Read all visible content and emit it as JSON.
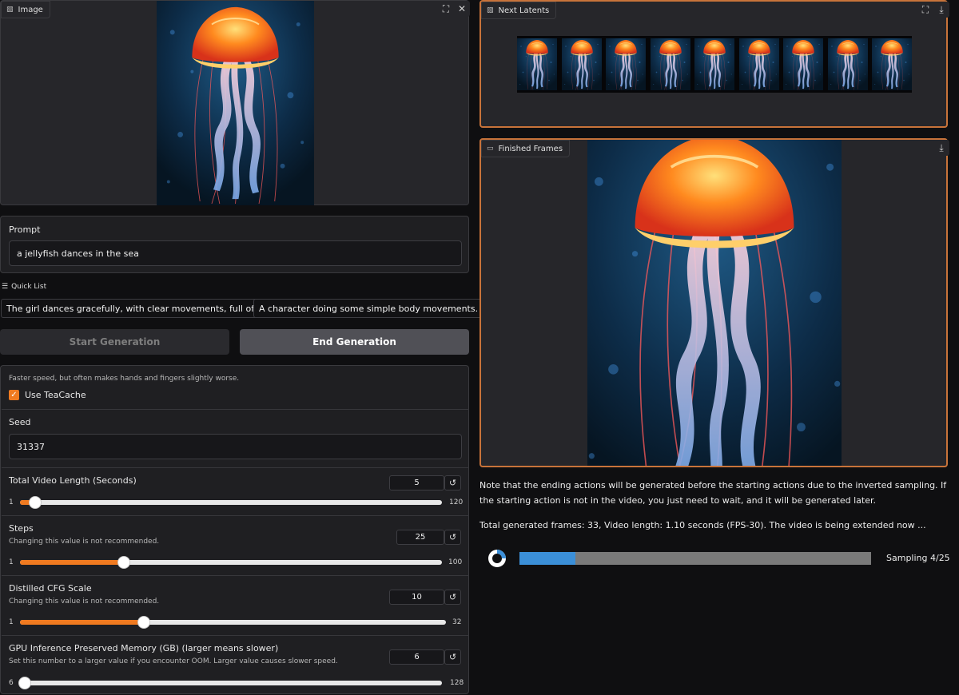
{
  "image_panel": {
    "label": "Image"
  },
  "prompt": {
    "label": "Prompt",
    "value": "a jellyfish dances in the sea"
  },
  "quick_list": {
    "label": "Quick List",
    "items": [
      "The girl dances gracefully, with clear movements, full of charm.",
      "A character doing some simple body movements."
    ]
  },
  "buttons": {
    "start": "Start Generation",
    "end": "End Generation"
  },
  "teacache": {
    "info": "Faster speed, but often makes hands and fingers slightly worse.",
    "label": "Use TeaCache",
    "checked": true
  },
  "seed": {
    "label": "Seed",
    "value": "31337"
  },
  "sliders": [
    {
      "label": "Total Video Length (Seconds)",
      "info": "",
      "value": "5",
      "min": "1",
      "max": "120",
      "fraction": 0.036
    },
    {
      "label": "Steps",
      "info": "Changing this value is not recommended.",
      "value": "25",
      "min": "1",
      "max": "100",
      "fraction": 0.246
    },
    {
      "label": "Distilled CFG Scale",
      "info": "Changing this value is not recommended.",
      "value": "10",
      "min": "1",
      "max": "32",
      "fraction": 0.29
    },
    {
      "label": "GPU Inference Preserved Memory (GB) (larger means slower)",
      "info": "Set this number to a larger value if you encounter OOM. Larger value causes slower speed.",
      "value": "6",
      "min": "6",
      "max": "128",
      "fraction": 0.0
    }
  ],
  "next_latents": {
    "label": "Next Latents",
    "frame_count": 9
  },
  "finished_frames": {
    "label": "Finished Frames"
  },
  "notes": {
    "ordering": "Note that the ending actions will be generated before the starting actions due to the inverted sampling. If the starting action is not in the video, you just need to wait, and it will be generated later.",
    "status": "Total generated frames: 33, Video length: 1.10 seconds (FPS-30). The video is being extended now ..."
  },
  "progress": {
    "label": "Sampling 4/25",
    "fraction": 0.16
  },
  "colors": {
    "accent": "#f07a20",
    "progress": "#3b8fd8",
    "panel": "#1f1f22"
  },
  "icons": {
    "image": "image-icon",
    "fullscreen": "fullscreen-icon",
    "close": "close-icon",
    "download": "download-icon",
    "video": "video-icon",
    "list": "list-icon",
    "reset": "reset-icon",
    "check": "check-icon",
    "spinner": "spinner-icon"
  }
}
